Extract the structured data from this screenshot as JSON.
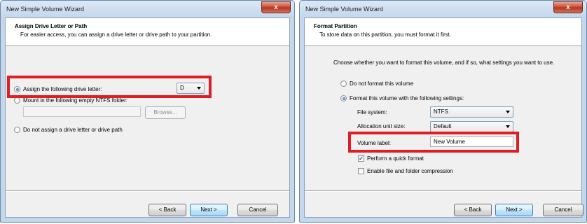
{
  "left_wizard": {
    "title": "New Simple Volume Wizard",
    "close_label": "x",
    "header_title": "Assign Drive Letter or Path",
    "header_subtitle": "For easier access, you can assign a drive letter or drive path to your partition.",
    "options": {
      "assign_letter": "Assign the following drive letter:",
      "mount_folder": "Mount in the following empty NTFS folder:",
      "no_assign": "Do not assign a drive letter or drive path"
    },
    "drive_letter": "D",
    "folder_path": "",
    "browse_label": "Browse...",
    "back_label": "< Back",
    "next_label": "Next >",
    "cancel_label": "Cancel"
  },
  "right_wizard": {
    "title": "New Simple Volume Wizard",
    "close_label": "x",
    "header_title": "Format Partition",
    "header_subtitle": "To store data on this partition, you must format it first.",
    "prompt": "Choose whether you want to format this volume, and if so, what settings you want to use.",
    "options": {
      "no_format": "Do not format this volume",
      "format": "Format this volume with the following settings:"
    },
    "file_system_label": "File system:",
    "file_system_value": "NTFS",
    "allocation_label": "Allocation unit size:",
    "allocation_value": "Default",
    "volume_label_label": "Volume label:",
    "volume_label_value": "New Volume",
    "quick_format_label": "Perform a quick format",
    "compression_label": "Enable file and folder compression",
    "checkmark": "✓",
    "back_label": "< Back",
    "next_label": "Next >",
    "cancel_label": "Cancel"
  },
  "colors": {
    "highlight": "#e01d25",
    "title_bar": "#c4d7ec",
    "close_button": "#c8462c"
  }
}
